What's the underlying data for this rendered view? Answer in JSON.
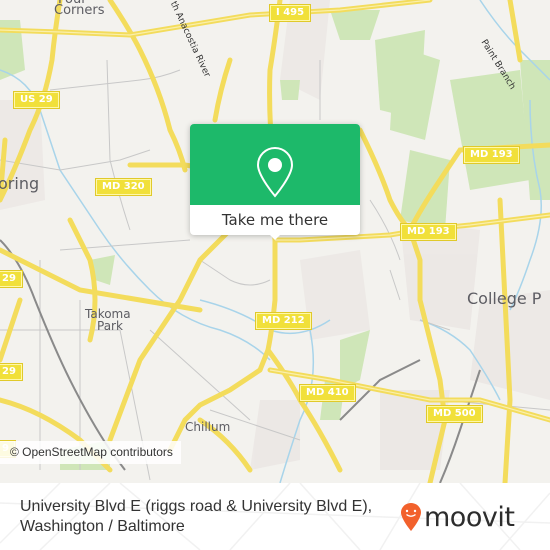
{
  "map": {
    "place_labels": [
      {
        "id": "four-corners",
        "text": "Four"
      },
      {
        "id": "four-corners-2",
        "text": "Corners"
      },
      {
        "id": "silver-spring",
        "text": "oring"
      },
      {
        "id": "takoma-park",
        "text": "Takoma"
      },
      {
        "id": "takoma-park-2",
        "text": "Park"
      },
      {
        "id": "chillum",
        "text": "Chillum"
      },
      {
        "id": "college-park",
        "text": "College P"
      }
    ],
    "river_labels": [
      {
        "id": "nw-anacostia",
        "text": "th Anacostia River"
      },
      {
        "id": "paint-branch",
        "text": "Paint Branch"
      }
    ],
    "route_shields": [
      {
        "id": "i495",
        "text": "I 495"
      },
      {
        "id": "us29-a",
        "text": "US 29"
      },
      {
        "id": "md320",
        "text": "MD 320"
      },
      {
        "id": "md193-a",
        "text": "MD 193"
      },
      {
        "id": "md193-b",
        "text": "MD 193"
      },
      {
        "id": "us29-b",
        "text": "29"
      },
      {
        "id": "us29-c",
        "text": "29"
      },
      {
        "id": "us29-d",
        "text": "9"
      },
      {
        "id": "md212",
        "text": "MD 212"
      },
      {
        "id": "md410",
        "text": "MD 410"
      },
      {
        "id": "md500",
        "text": "MD 500"
      }
    ],
    "attribution": "© OpenStreetMap contributors"
  },
  "popup": {
    "icon": "map-pin-icon",
    "button_label": "Take me there",
    "color": "#1db96a"
  },
  "footer": {
    "address_line1": "University Blvd E (riggs road & University Blvd E),",
    "address_line2": "Washington / Baltimore",
    "brand": "moovit",
    "brand_color": "#f2612c"
  }
}
